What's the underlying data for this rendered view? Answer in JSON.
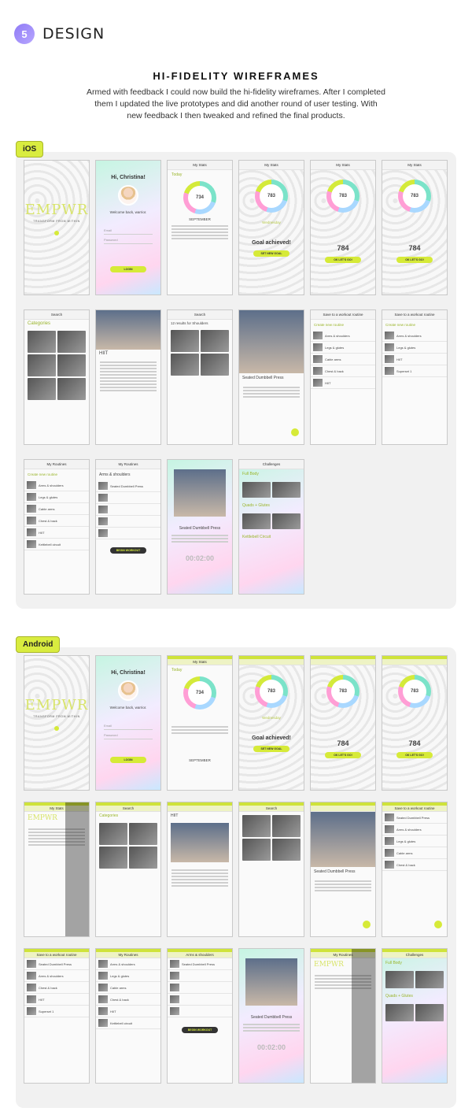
{
  "header": {
    "step_number": "5",
    "section_title": "DESIGN"
  },
  "wireframes": {
    "heading": "HI-FIDELITY WIREFRAMES",
    "intro": "Armed with feedback I could now build the hi-fidelity wireframes. After I completed them I updated the live prototypes and did another round of user testing. With new feedback I then tweaked and refined the final products."
  },
  "platforms": {
    "ios": {
      "label": "iOS"
    },
    "android": {
      "label": "Android"
    }
  },
  "screens": {
    "logo": "EMPWR",
    "logo_sub": "TRANSFORM FROM WITHIN",
    "greeting": "Hi, Christina!",
    "welcome": "Welcome back, warrior.",
    "email": "Email",
    "password": "Password",
    "login": "LOGIN",
    "my_stats": "My Stats",
    "calories": "734",
    "active_calories": "783",
    "goal": "784",
    "goal_achieved": "Goal achieved!",
    "set_new_goal": "SET NEW GOAL",
    "lets_go": "OK LET'S GO!",
    "categories": "Categories",
    "hiit": "HIIT",
    "search_results": "12 results for Shoulders",
    "exercise": "Seated Dumbbell Press",
    "save_to_routine": "Save to a workout routine",
    "create_routine": "Create new routine",
    "my_routines": "My Routines",
    "arms_shoulders": "Arms & shoulders",
    "begin_workout": "BEGIN WORKOUT",
    "timer": "00:02:00",
    "challenges": "Challenges",
    "full_body": "Full Body",
    "quads_glutes": "Quads + Glutes",
    "kettlebell": "Kettlebell Circuit",
    "today": "Today",
    "wednesday": "Wednesday",
    "september": "SEPTEMBER",
    "search": "Search",
    "routine_items": [
      "Arms & shoulders",
      "Legs & glutes",
      "Cable arms",
      "Chest & back",
      "HIIT",
      "Superset 1",
      "Kettlebell circuit"
    ]
  }
}
